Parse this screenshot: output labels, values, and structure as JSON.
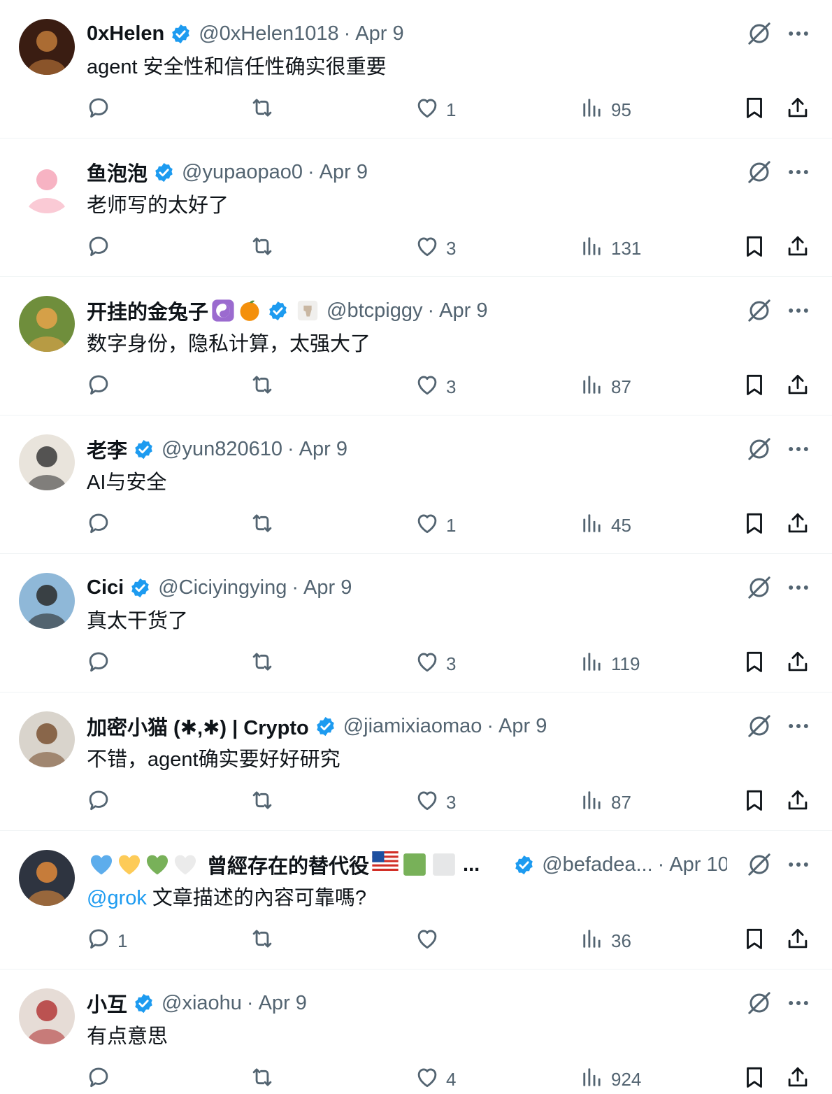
{
  "posts": [
    {
      "name": "0xHelen",
      "handle": "@0xHelen1018",
      "date": "Apr 9",
      "text": "agent 安全性和信任性确实很重要",
      "mention": "",
      "emojis": [],
      "replies": "",
      "retweets": "",
      "likes": "1",
      "views": "95",
      "avatar": {
        "bg": "#3a1d12",
        "fg": "#c07a3a"
      }
    },
    {
      "name": "鱼泡泡",
      "handle": "@yupaopao0",
      "date": "Apr 9",
      "text": "老师写的太好了",
      "mention": "",
      "emojis": [],
      "replies": "",
      "retweets": "",
      "likes": "3",
      "views": "131",
      "avatar": {
        "bg": "#ffffff",
        "fg": "#f6a6b9"
      }
    },
    {
      "name": "开挂的金兔子",
      "handle": "@btcpiggy",
      "date": "Apr 9",
      "text": "数字身份，隐私计算，太强大了",
      "mention": "",
      "emojis": [
        "yin-yang-emoji",
        "orange-emoji"
      ],
      "extra_emoji": "hand-emoji",
      "replies": "",
      "retweets": "",
      "likes": "3",
      "views": "87",
      "avatar": {
        "bg": "#6f8e3c",
        "fg": "#e7a34a"
      }
    },
    {
      "name": "老李",
      "handle": "@yun820610",
      "date": "Apr 9",
      "text": "AI与安全",
      "mention": "",
      "emojis": [],
      "replies": "",
      "retweets": "",
      "likes": "1",
      "views": "45",
      "avatar": {
        "bg": "#e9e4dc",
        "fg": "#3a3a3a"
      }
    },
    {
      "name": "Cici",
      "handle": "@Ciciyingying",
      "date": "Apr 9",
      "text": "真太干货了",
      "mention": "",
      "emojis": [],
      "replies": "",
      "retweets": "",
      "likes": "3",
      "views": "119",
      "avatar": {
        "bg": "#8fb8d8",
        "fg": "#2a2a2a"
      }
    },
    {
      "name": "加密小猫 (✱,✱) | Crypto",
      "handle": "@jiamixiaomao",
      "date": "Apr 9",
      "text": "不错，agent确实要好好研究",
      "mention": "",
      "emojis": [],
      "replies": "",
      "retweets": "",
      "likes": "3",
      "views": "87",
      "avatar": {
        "bg": "#d9d4cc",
        "fg": "#7a5232"
      }
    },
    {
      "name": "曾經存在的替代役",
      "handle": "@befadea...",
      "date": "Apr 10",
      "text": "文章描述的內容可靠嗎?",
      "mention": "@grok",
      "emojis": [
        "blue-heart-emoji",
        "yellow-heart-emoji",
        "green-heart-emoji",
        "white-heart-emoji"
      ],
      "suffix_emojis": [
        "us-flag-emoji",
        "green-square-emoji",
        "white-square-emoji"
      ],
      "ellipsis": "...",
      "replies": "1",
      "retweets": "",
      "likes": "",
      "views": "36",
      "avatar": {
        "bg": "#2e3440",
        "fg": "#e08a3a"
      }
    },
    {
      "name": "小互",
      "handle": "@xiaohu",
      "date": "Apr 9",
      "text": "有点意思",
      "mention": "",
      "emojis": [],
      "replies": "",
      "retweets": "",
      "likes": "4",
      "views": "924",
      "avatar": {
        "bg": "#e6dcd6",
        "fg": "#b33a3a"
      }
    }
  ],
  "colors": {
    "accent": "#1d9bf0",
    "secondary_text": "#536471",
    "verified": "#1d9bf0",
    "divider": "#eff3f4"
  }
}
